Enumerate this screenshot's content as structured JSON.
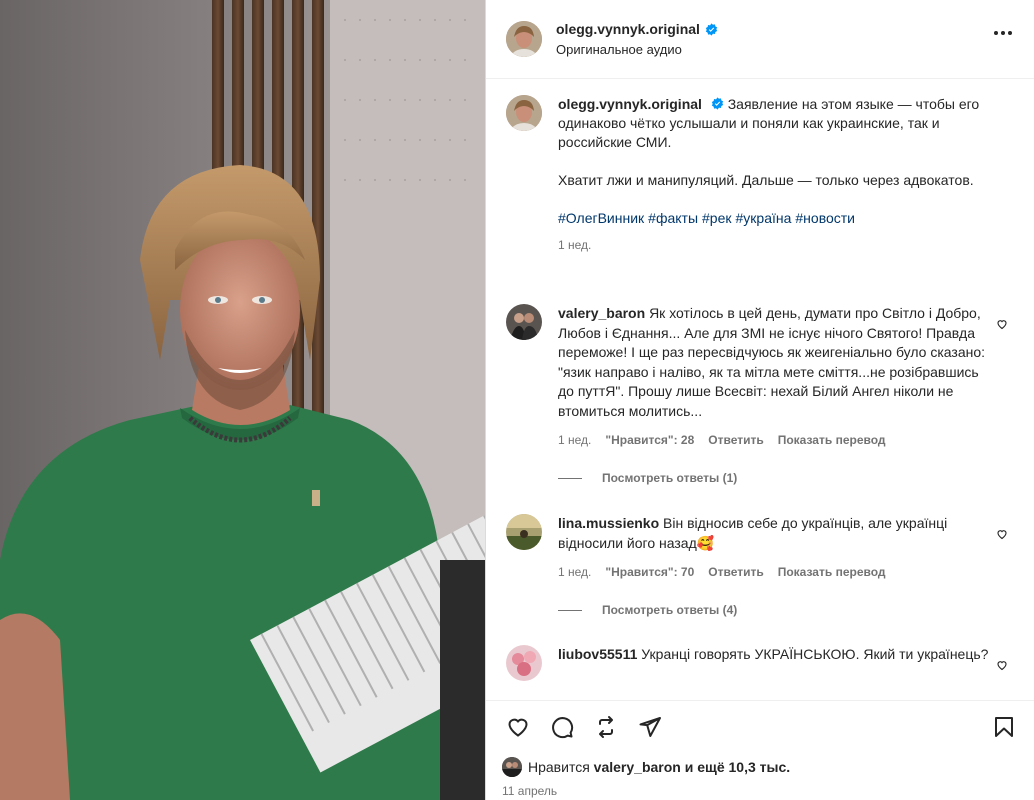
{
  "post": {
    "username": "olegg.vynnyk.original",
    "audio": "Оригинальное аудио"
  },
  "caption": {
    "username": "olegg.vynnyk.original",
    "text1": "Заявление на этом языке — чтобы его одинаково чётко услышали и поняли как украинские, так и российские СМИ.",
    "text2": "Хватит лжи и манипуляций. Дальше — только через адвокатов.",
    "hashtags": [
      "#ОлегВинник",
      "#факты",
      "#рек",
      "#україна",
      "#новости"
    ],
    "time": "1 нед."
  },
  "comments": [
    {
      "username": "valery_baron",
      "text": "Як хотілось в цей день, думати про Світло і Добро, Любов і Єднання... Але для ЗМІ не існує нічого Святого! Правда переможе! І ще раз пересвідчуюсь як жеигеніально було сказано: \"язик направо і наліво, як та мітла мете сміття...не розібравшись до путтЯ\". Прошу лише Всесвіт: нехай Білий Ангел ніколи не втомиться молитись...",
      "time": "1 нед.",
      "likes": "\"Нравится\": 28",
      "reply": "Ответить",
      "translate": "Показать перевод",
      "replies": "Посмотреть ответы (1)"
    },
    {
      "username": "lina.mussienko",
      "text": "Він відносив себе до українців, але українці відносили його назад🥰",
      "time": "1 нед.",
      "likes": "\"Нравится\": 70",
      "reply": "Ответить",
      "translate": "Показать перевод",
      "replies": "Посмотреть ответы (4)"
    },
    {
      "username": "liubov55511",
      "text": "Укранці говорять УКРАЇНСЬКОЮ. Який ти українець?"
    }
  ],
  "likes_line": {
    "prefix": "Нравится",
    "user": "valery_baron",
    "suffix": "и ещё 10,3 тыс."
  },
  "date": "11 апрель",
  "colors": {
    "link": "#00376b",
    "verified": "#0095f6",
    "secondary": "#737373",
    "shirt": "#2f7a4a"
  }
}
